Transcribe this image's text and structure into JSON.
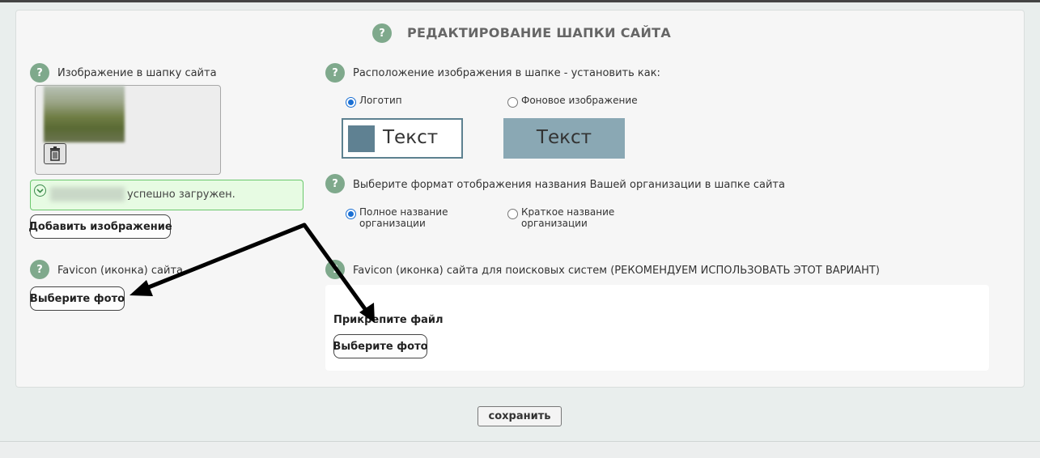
{
  "header": {
    "title": "РЕДАКТИРОВАНИЕ ШАПКИ САЙТА",
    "help_glyph": "?"
  },
  "left": {
    "header_image_label": "Изображение в шапку сайта",
    "upload_success_text": "успешно загружен.",
    "add_image_button": "Добавить изображение",
    "favicon_label": "Favicon (иконка) сайта",
    "choose_photo_button": "Выберите фото"
  },
  "right": {
    "placement_label": "Расположение изображения в шапке - установить как:",
    "placement_options": [
      {
        "label": "Логотип",
        "selected": true
      },
      {
        "label": "Фоновое изображение",
        "selected": false
      }
    ],
    "preview_text_logo": "Текст",
    "preview_text_background": "Текст",
    "name_format_label": "Выберите формат отображения названия Вашей организации в шапке сайта",
    "name_format_options": [
      {
        "label_line1": "Полное название",
        "label_line2": "организации",
        "selected": true
      },
      {
        "label_line1": "Краткое название",
        "label_line2": "организации",
        "selected": false
      }
    ],
    "search_favicon_label": "Favicon (иконка) сайта для поисковых систем (РЕКОМЕНДУЕМ ИСПОЛЬЗОВАТЬ ЭТОТ ВАРИАНТ)",
    "attach_file_label": "Прикрепите файл",
    "choose_photo_button": "Выберите фото"
  },
  "footer": {
    "save_button": "сохранить"
  },
  "colors": {
    "accent_help": "#7fa98c",
    "radio_selected": "#1a6fd3",
    "success_bg": "#e7fbe3",
    "success_border": "#6ac86c",
    "preview_logo": "#5f8192",
    "preview_background": "#8aa8b4"
  },
  "icons": [
    "help-icon",
    "trash-icon",
    "check-circle-icon",
    "arrow-annotation"
  ]
}
